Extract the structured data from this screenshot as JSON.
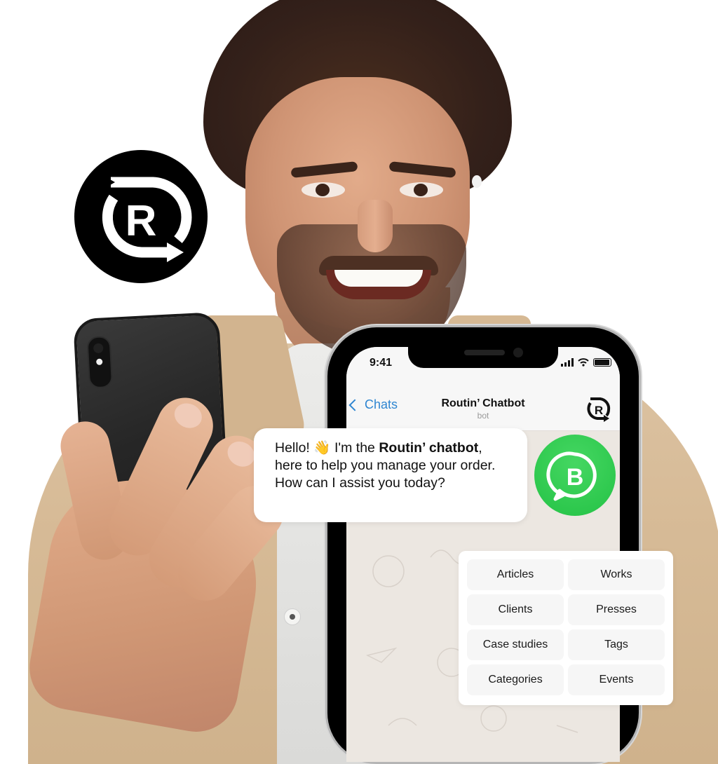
{
  "brand": {
    "logo_icon": "routin-r-circular-arrow-logo",
    "logo_bg": "#000000",
    "logo_fg": "#ffffff"
  },
  "phone": {
    "status_bar": {
      "time": "9:41",
      "icons": [
        "cellular-signal-icon",
        "wifi-icon",
        "battery-icon"
      ]
    },
    "nav": {
      "back_label": "Chats",
      "back_icon": "chevron-left-icon",
      "title": "Routin’ Chatbot",
      "subtitle": "bot",
      "avatar_icon": "routin-logo-icon",
      "accent": "#2f86d1"
    },
    "wallpaper": "doodle-pattern"
  },
  "message": {
    "greeting": "Hello!",
    "emoji": "👋",
    "lead": "I'm the",
    "bot_name": "Routin’ chatbot",
    "after_name": ",",
    "line2": "here to help you manage your order.",
    "line3": "How can I assist you today?"
  },
  "badge": {
    "icon": "whatsapp-business-icon",
    "letter": "B",
    "color": "#25c244"
  },
  "quick_replies": [
    {
      "label": "Articles"
    },
    {
      "label": "Works"
    },
    {
      "label": "Clients"
    },
    {
      "label": "Presses"
    },
    {
      "label": "Case studies"
    },
    {
      "label": "Tags"
    },
    {
      "label": "Categories"
    },
    {
      "label": "Events"
    }
  ]
}
